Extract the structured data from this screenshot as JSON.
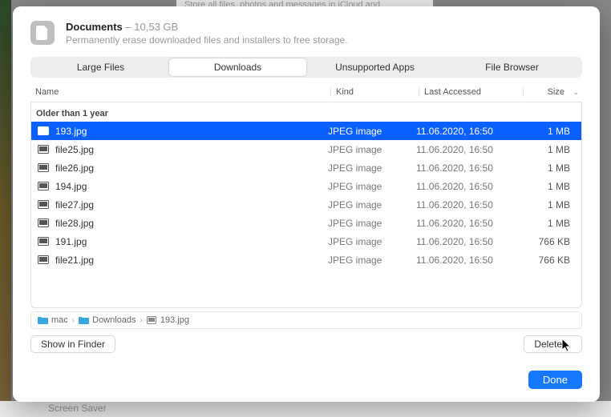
{
  "bg_snippet": "Store all files, photos and messages in iCloud and",
  "bg_item": "Screen Saver",
  "header": {
    "title": "Documents",
    "size": "10,53 GB",
    "subtitle": "Permanently erase downloaded files and installers to free storage."
  },
  "tabs": [
    {
      "label": "Large Files"
    },
    {
      "label": "Downloads"
    },
    {
      "label": "Unsupported Apps"
    },
    {
      "label": "File Browser"
    }
  ],
  "active_tab": 1,
  "columns": {
    "name": "Name",
    "kind": "Kind",
    "accessed": "Last Accessed",
    "size": "Size"
  },
  "group_label": "Older than 1 year",
  "files": [
    {
      "name": "193.jpg",
      "kind": "JPEG image",
      "accessed": "11.06.2020, 16:50",
      "size": "1 MB",
      "selected": true
    },
    {
      "name": "file25.jpg",
      "kind": "JPEG image",
      "accessed": "11.06.2020, 16:50",
      "size": "1 MB",
      "selected": false
    },
    {
      "name": "file26.jpg",
      "kind": "JPEG image",
      "accessed": "11.06.2020, 16:50",
      "size": "1 MB",
      "selected": false
    },
    {
      "name": "194.jpg",
      "kind": "JPEG image",
      "accessed": "11.06.2020, 16:50",
      "size": "1 MB",
      "selected": false
    },
    {
      "name": "file27.jpg",
      "kind": "JPEG image",
      "accessed": "11.06.2020, 16:50",
      "size": "1 MB",
      "selected": false
    },
    {
      "name": "file28.jpg",
      "kind": "JPEG image",
      "accessed": "11.06.2020, 16:50",
      "size": "1 MB",
      "selected": false
    },
    {
      "name": "191.jpg",
      "kind": "JPEG image",
      "accessed": "11.06.2020, 16:50",
      "size": "766 KB",
      "selected": false
    },
    {
      "name": "file21.jpg",
      "kind": "JPEG image",
      "accessed": "11.06.2020, 16:50",
      "size": "766 KB",
      "selected": false
    }
  ],
  "breadcrumb": [
    "mac",
    "Downloads",
    "193.jpg"
  ],
  "buttons": {
    "show_in_finder": "Show in Finder",
    "delete": "Delete…",
    "done": "Done"
  }
}
